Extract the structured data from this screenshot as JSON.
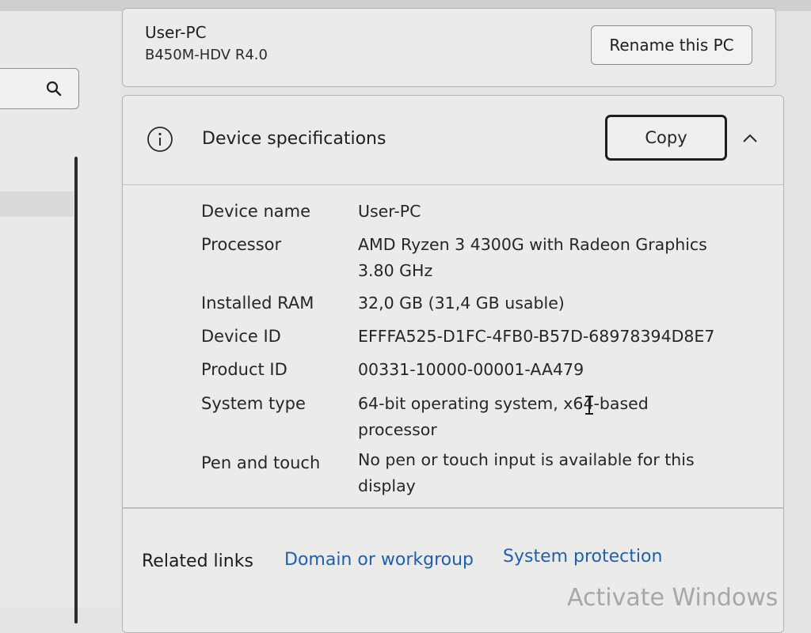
{
  "pc": {
    "name": "User-PC",
    "model": "B450M-HDV R4.0",
    "rename_label": "Rename this PC"
  },
  "search": {
    "icon": "search-icon"
  },
  "specs": {
    "title": "Device specifications",
    "copy_label": "Copy",
    "rows": [
      {
        "label": "Device name",
        "value": "User-PC"
      },
      {
        "label": "Processor",
        "value": "AMD Ryzen 3 4300G with Radeon Graphics 3.80 GHz"
      },
      {
        "label": "Installed RAM",
        "value": "32,0 GB (31,4 GB usable)"
      },
      {
        "label": "Device ID",
        "value": "EFFFA525-D1FC-4FB0-B57D-68978394D8E7"
      },
      {
        "label": "Product ID",
        "value": "00331-10000-00001-AA479"
      },
      {
        "label": "System type",
        "value": "64-bit operating system, x64-based processor"
      },
      {
        "label": "Pen and touch",
        "value": "No pen or touch input is available for this display"
      }
    ]
  },
  "related": {
    "label": "Related links",
    "links": [
      "Domain or workgroup",
      "System protection"
    ]
  },
  "watermark": "Activate Windows",
  "colors": {
    "link": "#1f5fb0",
    "background": "#e4e5e3"
  }
}
